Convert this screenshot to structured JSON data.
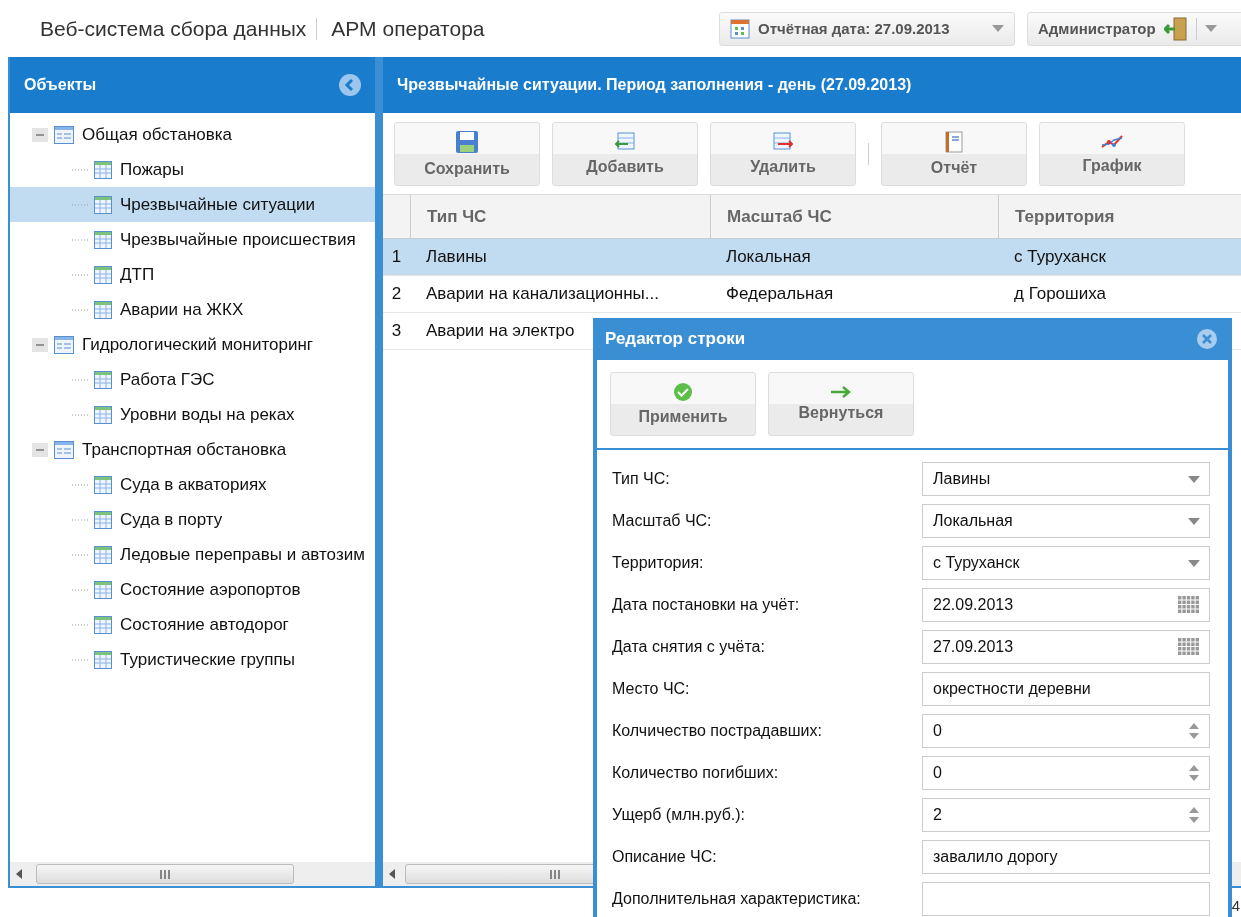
{
  "header": {
    "app_title": "Веб-система сбора данных",
    "module_title": "АРМ оператора",
    "report_date": "Отчётная дата: 27.09.2013",
    "user": "Администратор"
  },
  "objects_panel": {
    "title": "Объекты",
    "tree": [
      {
        "label": "Общая обстановка",
        "expanded": true,
        "selected": false,
        "children": [
          {
            "label": "Пожары",
            "selected": false
          },
          {
            "label": "Чрезвычайные ситуации",
            "selected": true
          },
          {
            "label": "Чрезвычайные происшествия",
            "selected": false
          },
          {
            "label": "ДТП",
            "selected": false
          },
          {
            "label": "Аварии на ЖКХ",
            "selected": false
          }
        ]
      },
      {
        "label": "Гидрологический мониторинг",
        "expanded": true,
        "selected": false,
        "children": [
          {
            "label": "Работа ГЭС",
            "selected": false
          },
          {
            "label": "Уровни воды на реках",
            "selected": false
          }
        ]
      },
      {
        "label": "Транспортная обстановка",
        "expanded": true,
        "selected": false,
        "children": [
          {
            "label": "Суда в акваториях",
            "selected": false
          },
          {
            "label": "Суда в порту",
            "selected": false
          },
          {
            "label": "Ледовые переправы и автозим",
            "selected": false
          },
          {
            "label": "Состояние аэропортов",
            "selected": false
          },
          {
            "label": "Состояние автодорог",
            "selected": false
          },
          {
            "label": "Туристические группы",
            "selected": false
          }
        ]
      }
    ]
  },
  "data_panel": {
    "title": "Чрезвычайные ситуации. Период заполнения - день (27.09.2013)",
    "toolbar": [
      {
        "kind": "save",
        "label": "Сохранить",
        "separator_before": false
      },
      {
        "kind": "add",
        "label": "Добавить",
        "separator_before": false
      },
      {
        "kind": "delete",
        "label": "Удалить",
        "separator_before": false
      },
      {
        "kind": "report",
        "label": "Отчёт",
        "separator_before": true
      },
      {
        "kind": "chart",
        "label": "График",
        "separator_before": false
      }
    ],
    "table": {
      "columns": [
        "Тип ЧС",
        "Масштаб ЧС",
        "Территория"
      ],
      "rows": [
        {
          "number": "1",
          "cells": [
            "Лавины",
            "Локальная",
            "с Туруханск"
          ],
          "selected": true
        },
        {
          "number": "2",
          "cells": [
            "Аварии на канализационны...",
            "Федеральная",
            "д Горошиха"
          ],
          "selected": false
        },
        {
          "number": "3",
          "cells": [
            "Аварии на электро"
          ],
          "selected": false
        }
      ]
    }
  },
  "status_bar": {
    "text": "4"
  },
  "row_editor": {
    "title": "Редактор строки",
    "buttons": [
      {
        "kind": "apply",
        "label": "Применить"
      },
      {
        "kind": "back",
        "label": "Вернуться"
      }
    ],
    "fields": [
      {
        "kind": "select",
        "label": "Тип ЧС:",
        "value": "Лавины"
      },
      {
        "kind": "select",
        "label": "Масштаб ЧС:",
        "value": "Локальная"
      },
      {
        "kind": "select",
        "label": "Территория:",
        "value": "с Туруханск"
      },
      {
        "kind": "date",
        "label": "Дата постановки на учёт:",
        "value": "22.09.2013"
      },
      {
        "kind": "date",
        "label": "Дата снятия с учёта:",
        "value": "27.09.2013"
      },
      {
        "kind": "text",
        "label": "Место ЧС:",
        "value": "окрестности деревни"
      },
      {
        "kind": "number",
        "label": "Колчичество пострадавших:",
        "value": "0"
      },
      {
        "kind": "number",
        "label": "Количество погибших:",
        "value": "0"
      },
      {
        "kind": "number",
        "label": "Ущерб (млн.руб.):",
        "value": "2"
      },
      {
        "kind": "text",
        "label": "Описание ЧС:",
        "value": "завалило дорогу"
      },
      {
        "kind": "text",
        "label": "Дополнительная характеристика:"
      }
    ]
  }
}
